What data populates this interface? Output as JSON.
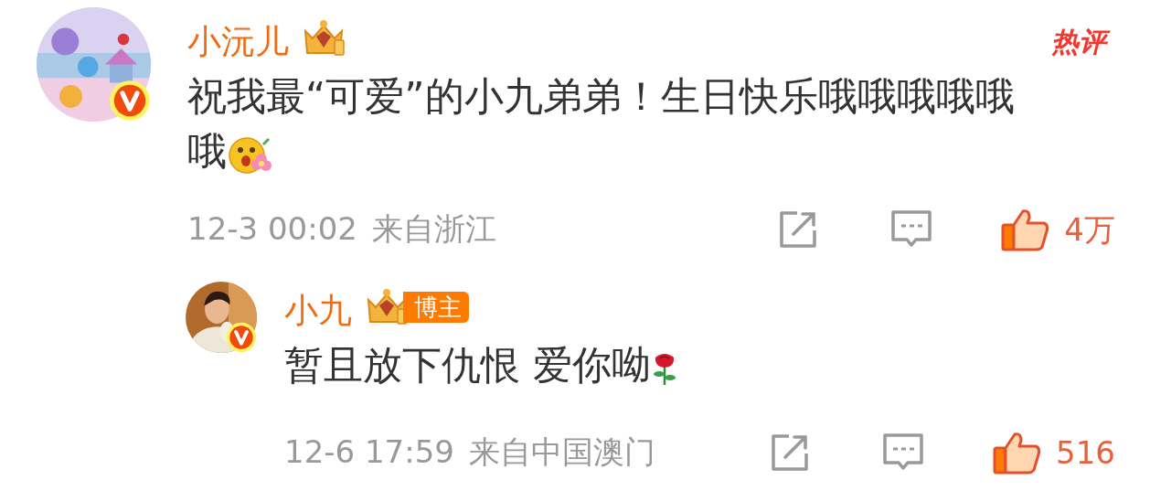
{
  "comments": [
    {
      "user": {
        "name": "小沅儿",
        "verified": true,
        "badge": {
          "kind": "crown"
        }
      },
      "hot_label": "热评",
      "text": "祝我最“可爱”的小九弟弟！生日快乐哦哦哦哦哦哦",
      "sticker": {
        "kind": "flower-smile"
      },
      "time": "12-3 00:02",
      "location": "来自浙江",
      "likes": "4万",
      "liked": true,
      "replies": [
        {
          "user": {
            "name": "小九",
            "verified": true,
            "badge": {
              "kind": "crown",
              "label": "博主"
            }
          },
          "text": "暂且放下仇恨 爱你呦",
          "sticker": {
            "kind": "rose"
          },
          "time": "12-6 17:59",
          "location": "来自中国澳门",
          "likes": "516",
          "liked": true
        }
      ]
    }
  ]
}
